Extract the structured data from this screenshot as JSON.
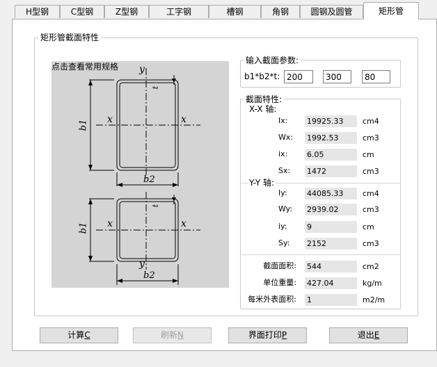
{
  "tabs": [
    {
      "label": "H型钢"
    },
    {
      "label": "C型钢"
    },
    {
      "label": "Z型钢"
    },
    {
      "label": "工字钢"
    },
    {
      "label": "槽钢"
    },
    {
      "label": "角钢"
    },
    {
      "label": "圆钢及圆管"
    },
    {
      "label": "矩形管"
    }
  ],
  "section_group_title": "矩形管截面特性",
  "drawing": {
    "caption": "点击查看常用规格",
    "axis_x": "x",
    "axis_y": "y",
    "dim_b1": "b1",
    "dim_b2": "b2",
    "dim_t": "t"
  },
  "input": {
    "title": "输入截面参数:",
    "label": "b1*b2*t:",
    "b1": "200",
    "b2": "300",
    "t": "80"
  },
  "props": {
    "title": "截面特性:",
    "xx_title": "X-X 轴:",
    "yy_title": "Y-Y 轴:",
    "xx": [
      {
        "name": "Ix:",
        "value": "19925.33",
        "unit": "cm4"
      },
      {
        "name": "Wx:",
        "value": "1992.53",
        "unit": "cm3"
      },
      {
        "name": "ix:",
        "value": "6.05",
        "unit": "cm"
      },
      {
        "name": "Sx:",
        "value": "1472",
        "unit": "cm3"
      }
    ],
    "yy": [
      {
        "name": "Iy:",
        "value": "44085.33",
        "unit": "cm4"
      },
      {
        "name": "Wy:",
        "value": "2939.02",
        "unit": "cm3"
      },
      {
        "name": "iy:",
        "value": "9",
        "unit": "cm"
      },
      {
        "name": "Sy:",
        "value": "2152",
        "unit": "cm3"
      }
    ],
    "other": [
      {
        "name": "截面面积:",
        "value": "544",
        "unit": "cm2"
      },
      {
        "name": "单位重量:",
        "value": "427.04",
        "unit": "kg/m"
      },
      {
        "name": "每米外表面积:",
        "value": "1",
        "unit": "m2/m"
      }
    ]
  },
  "buttons": {
    "calc": {
      "text": "计算",
      "key": "C"
    },
    "refresh": {
      "text": "刷新",
      "key": "N"
    },
    "print": {
      "text": "界面打印",
      "key": "P"
    },
    "exit": {
      "text": "退出",
      "key": "E"
    }
  }
}
